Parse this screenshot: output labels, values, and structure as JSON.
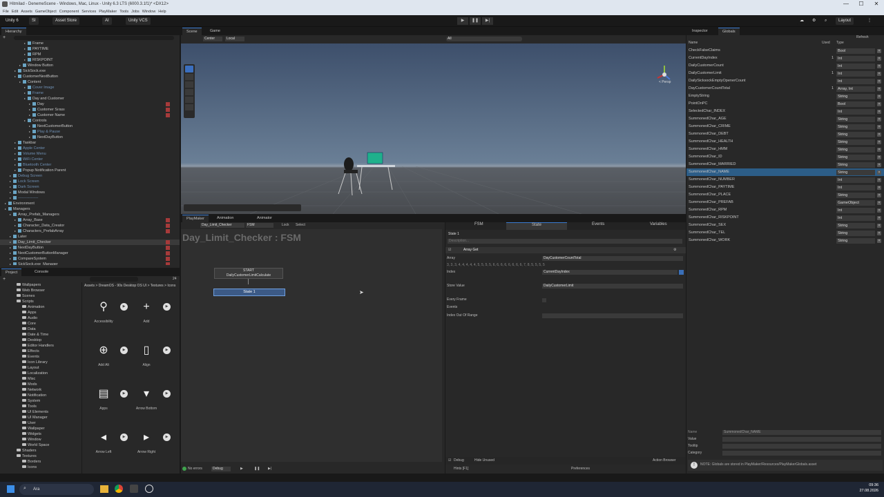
{
  "window": {
    "title": "Hitmilad - DenemeScene - Windows, Mac, Linux - Unity 6.3 LTS (6000.3.1f1)* <DX12>",
    "min": "—",
    "max": "☐",
    "close": "✕"
  },
  "menu": [
    "File",
    "Edit",
    "Assets",
    "GameObject",
    "Component",
    "Services",
    "PlayMaker",
    "Tools",
    "Jobs",
    "Window",
    "Help"
  ],
  "toolbar": {
    "account": "Unity 6",
    "si": "SI",
    "asset_store": "Asset Store",
    "ai": "AI",
    "vcs": "Unity VCS",
    "layout": "Layout",
    "play": "▶",
    "pause": "❚❚",
    "step": "▶|"
  },
  "hierarchy": {
    "tab": "Hierarchy",
    "items": [
      {
        "label": "Frame",
        "indent": 5,
        "dim": false
      },
      {
        "label": "PAYTIME",
        "indent": 5,
        "dim": false
      },
      {
        "label": "RPM",
        "indent": 5,
        "dim": false
      },
      {
        "label": "RISKPOINT",
        "indent": 5,
        "dim": false
      },
      {
        "label": "Window Button",
        "indent": 4,
        "dim": false
      },
      {
        "label": "SickSock.exe",
        "indent": 3,
        "dim": false
      },
      {
        "label": "CustomerNextButton",
        "indent": 3,
        "dim": false
      },
      {
        "label": "Content",
        "indent": 4,
        "dim": false
      },
      {
        "label": "Cover Image",
        "indent": 5,
        "dim": true
      },
      {
        "label": "Frame",
        "indent": 5,
        "dim": true
      },
      {
        "label": "Day and Customer",
        "indent": 5,
        "dim": false
      },
      {
        "label": "Day",
        "indent": 6,
        "dim": false,
        "red": true
      },
      {
        "label": "Customer Sırası",
        "indent": 6,
        "dim": false,
        "red": true
      },
      {
        "label": "Customer Name",
        "indent": 6,
        "dim": false,
        "red": true
      },
      {
        "label": "Controls",
        "indent": 5,
        "dim": false
      },
      {
        "label": "NextCustomerButton",
        "indent": 6,
        "dim": false
      },
      {
        "label": "Play & Pause",
        "indent": 6,
        "dim": true
      },
      {
        "label": "NextDayButton",
        "indent": 6,
        "dim": false
      },
      {
        "label": "Taskbar",
        "indent": 3,
        "dim": false
      },
      {
        "label": "Apple Center",
        "indent": 3,
        "dim": true
      },
      {
        "label": "Volume Menu",
        "indent": 3,
        "dim": true
      },
      {
        "label": "WiFi Center",
        "indent": 3,
        "dim": true
      },
      {
        "label": "Bluetooth Center",
        "indent": 3,
        "dim": true
      },
      {
        "label": "Popup Notification Parent",
        "indent": 3,
        "dim": false
      },
      {
        "label": "Debug Screen",
        "indent": 2,
        "dim": true
      },
      {
        "label": "Lock Screen",
        "indent": 2,
        "dim": true
      },
      {
        "label": "Dark Screen",
        "indent": 2,
        "dim": true
      },
      {
        "label": "Modal Windows",
        "indent": 2,
        "dim": false
      },
      {
        "label": "----------------",
        "indent": 2,
        "dim": true
      },
      {
        "label": "Environment",
        "indent": 1,
        "dim": false
      },
      {
        "label": "Managers",
        "indent": 1,
        "dim": false
      },
      {
        "label": "Array_Prefab_Managers",
        "indent": 2,
        "dim": false
      },
      {
        "label": "Array_Base",
        "indent": 3,
        "dim": false,
        "red": true
      },
      {
        "label": "Character_Data_Creator",
        "indent": 3,
        "dim": false,
        "red": true
      },
      {
        "label": "Characters_PrefabArray",
        "indent": 3,
        "dim": false,
        "red": true
      },
      {
        "label": "Later",
        "indent": 2,
        "dim": false
      },
      {
        "label": "Day_Limit_Checker",
        "indent": 2,
        "dim": false,
        "red": true
      },
      {
        "label": "NextDayButton",
        "indent": 2,
        "dim": false,
        "red": true
      },
      {
        "label": "NextCustomerButtonManager",
        "indent": 2,
        "dim": false,
        "red": true
      },
      {
        "label": "CompareSystem",
        "indent": 2,
        "dim": false,
        "red": true
      },
      {
        "label": "SickSock.exe_Manager",
        "indent": 2,
        "dim": false,
        "red": true
      }
    ]
  },
  "scene": {
    "tabs": [
      "Scene",
      "Game"
    ],
    "pivot": "Center",
    "space": "Local",
    "persp": "< Persp",
    "search_placeholder": "All"
  },
  "project": {
    "tabs": [
      "Project",
      "Console"
    ],
    "breadcrumb": "Assets > DreamOS - 90s Desktop OS UI > Textures > Icons",
    "count": "24",
    "folders": [
      "Wallpapers",
      "Web Browser",
      "Scenes",
      "Scripts",
      "Animation",
      "Apps",
      "Audio",
      "Core",
      "Data",
      "Date & Time",
      "Desktop",
      "Editor Handlers",
      "Effects",
      "Events",
      "Icon Library",
      "Layout",
      "Localization",
      "Misc",
      "Mods",
      "Network",
      "Notification",
      "System",
      "Tools",
      "UI Elements",
      "UI Manager",
      "User",
      "Wallpaper",
      "Widgets",
      "Window",
      "World Space",
      "Shaders",
      "Textures",
      "Borders",
      "Icons"
    ],
    "icons": [
      {
        "label": "Accessibility",
        "glyph": "⚲"
      },
      {
        "label": "Add",
        "glyph": "+"
      },
      {
        "label": "Add Alt",
        "glyph": "⊕"
      },
      {
        "label": "Align",
        "glyph": "▯"
      },
      {
        "label": "Apps",
        "glyph": "▤"
      },
      {
        "label": "Arrow Bottom",
        "glyph": "▾"
      },
      {
        "label": "Arrow Left",
        "glyph": "◂"
      },
      {
        "label": "Arrow Right",
        "glyph": "▸"
      }
    ]
  },
  "playmaker": {
    "tabs": [
      "PlayMaker",
      "Animation",
      "Animator"
    ],
    "fsm_select": "Day_Limit_Checker",
    "fsm_name": "FSM",
    "lock": "Lock",
    "select": "Select",
    "title": "Day_Limit_Checker : FSM",
    "start_label": "START",
    "start_event": "DailyCustomerLimitCalculate",
    "state": "State 1",
    "no_errors": "No errors",
    "debug": "Debug",
    "debug_check": "Debug",
    "hide_unused": "Hide Unused",
    "action_browser": "Action Browser",
    "hints": "Hints [F1]",
    "preferences": "Preferences"
  },
  "state_panel": {
    "tabs": [
      "FSM",
      "State",
      "Events",
      "Variables"
    ],
    "state_name": "State 1",
    "description_placeholder": "Description...",
    "action": "Array Get",
    "array_label": "Array",
    "array_value": "DayCustomerCountTotal",
    "array_contents": "3, 3, 3, 4, 4, 4, 4, 4, 5, 5, 5, 5, 6, 6, 6, 6, 6, 6, 6, 6, 7, 8, 5, 5, 5, 5",
    "index_label": "Index",
    "index_value": "CurrentDayIndex",
    "store_label": "Store Value",
    "store_value": "DailyCustomerLimit",
    "every_frame": "Every Frame",
    "events": "Events",
    "out_of_range": "Index Out Of Range"
  },
  "inspector": {
    "tabs": [
      "Inspector",
      "Globals"
    ],
    "refresh": "Refresh",
    "col_name": "Name",
    "col_used": "Used",
    "col_type": "Type",
    "rows": [
      {
        "name": "CheckFalseClaims",
        "used": "",
        "type": "Bool"
      },
      {
        "name": "CurrentDayIndex",
        "used": "1",
        "type": "Int"
      },
      {
        "name": "DailyCustomerCount",
        "used": "",
        "type": "Int"
      },
      {
        "name": "DailyCustomerLimit",
        "used": "1",
        "type": "Int"
      },
      {
        "name": "DailySicksockEmptyOpenerCount",
        "used": "",
        "type": "Int"
      },
      {
        "name": "DayCustomerCountTotal",
        "used": "1",
        "type": "Array, Int"
      },
      {
        "name": "EmptyString",
        "used": "",
        "type": "String"
      },
      {
        "name": "PointOnPC",
        "used": "",
        "type": "Bool"
      },
      {
        "name": "SelectedChar_INDEX",
        "used": "",
        "type": "Int"
      },
      {
        "name": "SummonedChar_AGE",
        "used": "",
        "type": "String"
      },
      {
        "name": "SummonedChar_CRIME",
        "used": "",
        "type": "String"
      },
      {
        "name": "SummonedChar_DEBT",
        "used": "",
        "type": "String"
      },
      {
        "name": "SummonedChar_HEALTH",
        "used": "",
        "type": "String"
      },
      {
        "name": "SummonedChar_HMM",
        "used": "",
        "type": "String"
      },
      {
        "name": "SummonedChar_ID",
        "used": "",
        "type": "String"
      },
      {
        "name": "SummonedChar_MARRIED",
        "used": "",
        "type": "String"
      },
      {
        "name": "SummonedChar_NAME",
        "used": "",
        "type": "String",
        "selected": true
      },
      {
        "name": "SummonedChar_NUMBER",
        "used": "",
        "type": "Int"
      },
      {
        "name": "SummonedChar_PAYTIME",
        "used": "",
        "type": "Int"
      },
      {
        "name": "SummonedChar_PLACE",
        "used": "",
        "type": "String"
      },
      {
        "name": "SummonedChar_PREFAB",
        "used": "",
        "type": "GameObject"
      },
      {
        "name": "SummonedChar_RPM",
        "used": "",
        "type": "Int"
      },
      {
        "name": "SummonedChar_RISKPOINT",
        "used": "",
        "type": "Int"
      },
      {
        "name": "SummonedChar_SEX",
        "used": "",
        "type": "String"
      },
      {
        "name": "SummonedChar_TEL",
        "used": "",
        "type": "String"
      },
      {
        "name": "SummonedChar_WORK",
        "used": "",
        "type": "String"
      }
    ],
    "detail": {
      "name_label": "Name",
      "name_value": "SummonedChar_NAME",
      "value_label": "Value",
      "tooltip_label": "Tooltip",
      "category_label": "Category"
    },
    "note": "NOTE: Globals are stored in PlayMaker/Resources/PlayMakerGlobals.asset"
  },
  "taskbar": {
    "search": "Ara",
    "time": "09:36",
    "date": "27.08.2026"
  }
}
